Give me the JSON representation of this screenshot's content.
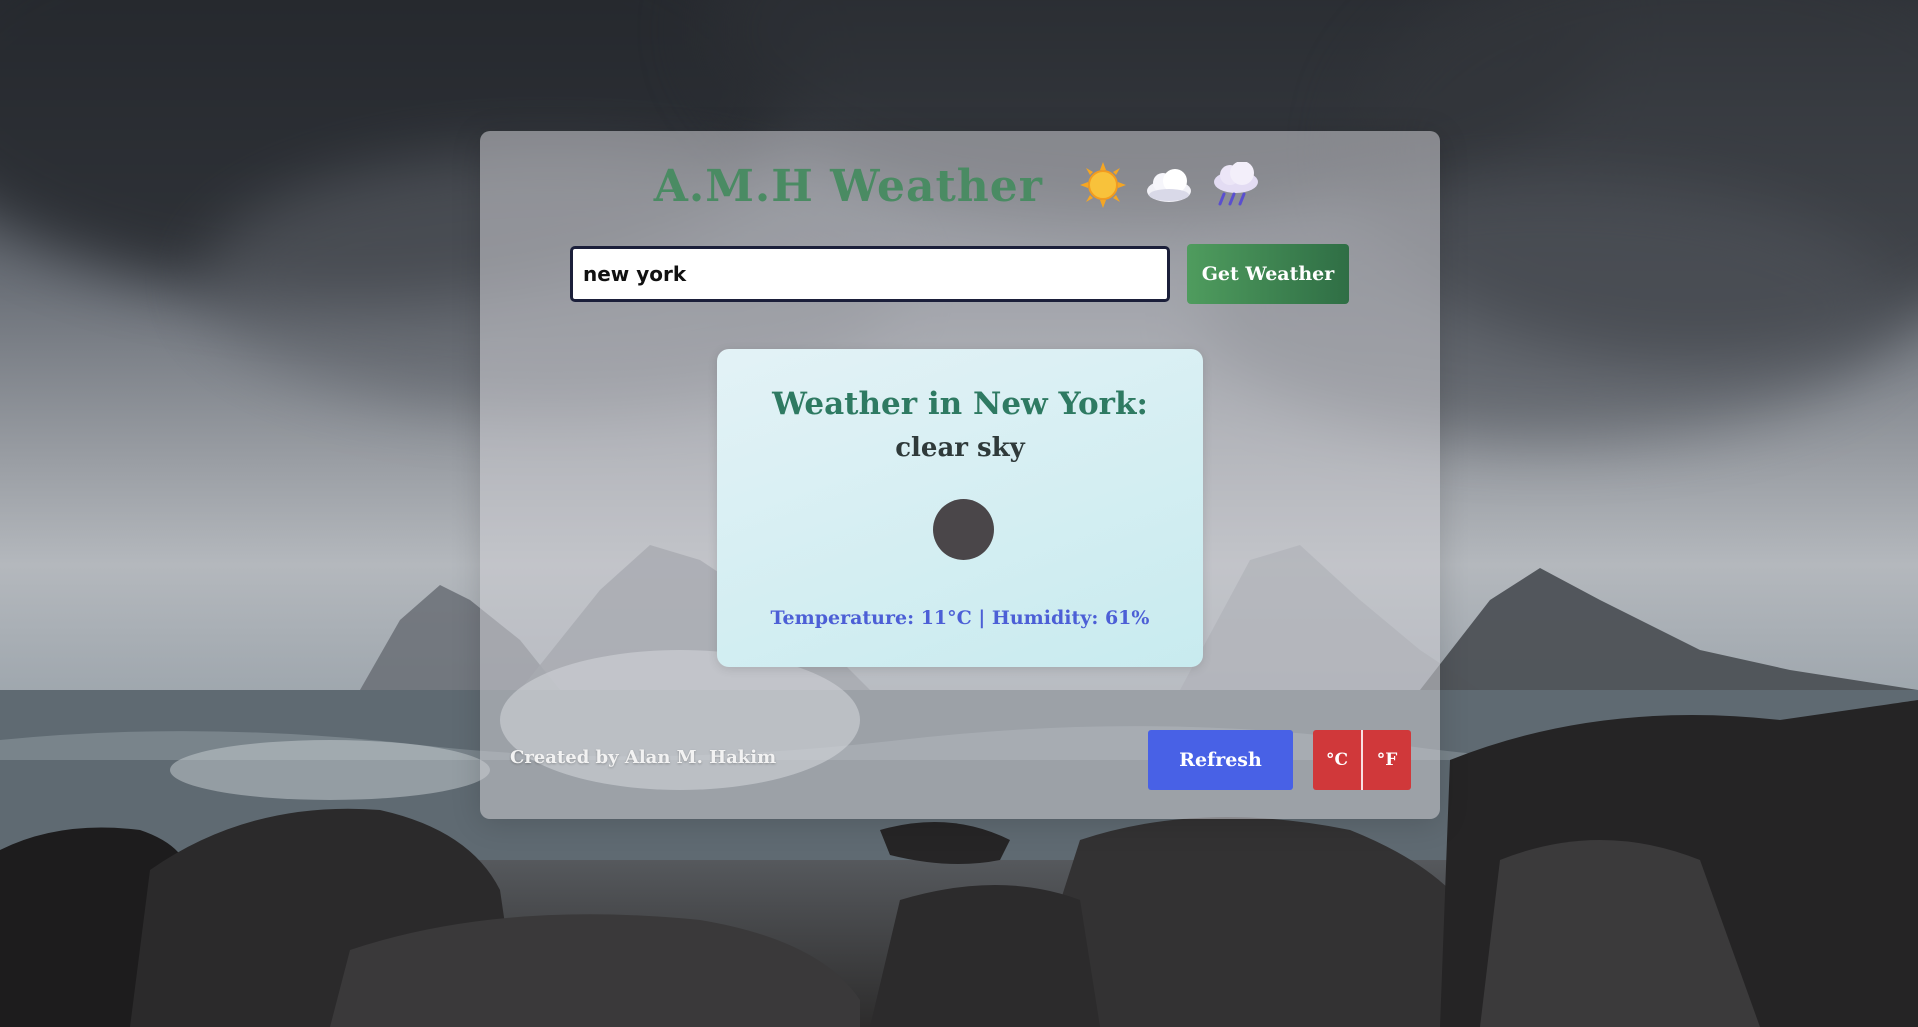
{
  "app": {
    "title": "A.M.H Weather",
    "title_emojis": [
      "sun-icon",
      "cloud-icon",
      "rain-cloud-icon"
    ]
  },
  "search": {
    "value": "new york",
    "button_label": "Get Weather"
  },
  "result": {
    "heading": "Weather in New York:",
    "description": "clear sky",
    "weather_icon": "weather-condition-icon",
    "stats": "Temperature: 11°C | Humidity: 61%"
  },
  "footer": {
    "credit": "Created by Alan M. Hakim",
    "refresh_label": "Refresh",
    "unit_celsius": "°C",
    "unit_fahrenheit": "°F"
  },
  "colors": {
    "title": "#4a8b63",
    "get_weather_button": "#3f8a52",
    "refresh_button": "#4861e6",
    "unit_toggle": "#d0383a",
    "stats_text": "#4c5fd6"
  }
}
